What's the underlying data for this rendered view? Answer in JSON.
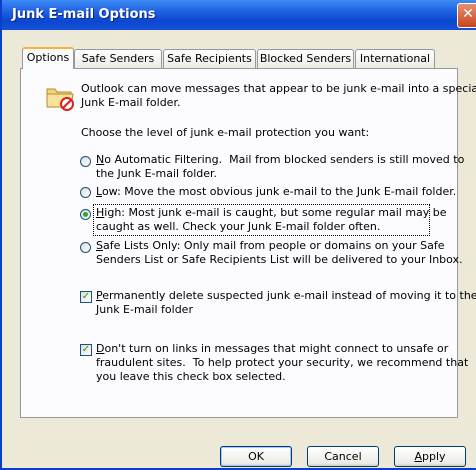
{
  "window": {
    "title": "Junk E-mail Options",
    "close_glyph": "✕"
  },
  "tabs": [
    {
      "label": "Options",
      "active": true
    },
    {
      "label": "Safe Senders"
    },
    {
      "label": "Safe Recipients"
    },
    {
      "label": "Blocked Senders"
    },
    {
      "label": "International"
    }
  ],
  "intro": {
    "line1": "Outlook can move messages that appear to be junk e-mail into a special",
    "line2": "Junk E-mail folder."
  },
  "prompt": "Choose the level of junk e-mail protection you want:",
  "levels": [
    {
      "key": "N",
      "rest1": "o Automatic Filtering.  Mail from blocked senders is still moved to",
      "line2": "the Junk E-mail folder.",
      "selected": false
    },
    {
      "key": "L",
      "rest1": "ow: Move the most obvious junk e-mail to the Junk E-mail folder.",
      "line2": "",
      "selected": false
    },
    {
      "key": "H",
      "rest1": "igh: Most junk e-mail is caught, but some regular mail may be",
      "line2": "caught as well. Check your Junk E-mail folder often.",
      "selected": true
    },
    {
      "key": "S",
      "rest1": "afe Lists Only: Only mail from people or domains on your Safe",
      "line2": "Senders List or Safe Recipients List will be delivered to your Inbox.",
      "selected": false
    }
  ],
  "options": {
    "permanently_delete": {
      "key": "P",
      "rest1": "ermanently delete suspected junk e-mail instead of moving it to the",
      "line2": "Junk E-mail folder",
      "checked": true
    },
    "dont_turn_on_links": {
      "key": "D",
      "rest1": "on't turn on links in messages that might connect to unsafe or",
      "line2": "fraudulent sites.  To help protect your security, we recommend that",
      "line3": "you leave this check box selected.",
      "checked": true
    }
  },
  "buttons": {
    "ok": "OK",
    "cancel": "Cancel",
    "apply_key": "A",
    "apply_rest": "pply"
  },
  "colors": {
    "titlebar": "#0b46d0",
    "dialog_bg": "#ece9d8",
    "radio_selected": "#31a531"
  }
}
